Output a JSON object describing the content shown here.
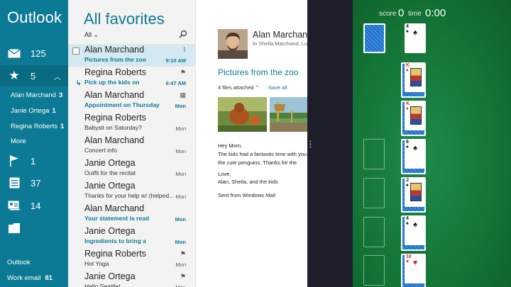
{
  "nav": {
    "app_title": "Outlook",
    "inbox_count": "125",
    "favorites_count": "5",
    "favorites": [
      {
        "name": "Alan Marchand",
        "count": "3"
      },
      {
        "name": "Janie Ortega",
        "count": "1"
      },
      {
        "name": "Regina Roberts",
        "count": "1"
      }
    ],
    "more_label": "More",
    "flagged_count": "1",
    "calendar_count": "37",
    "contacts_count": "14",
    "accounts": [
      {
        "name": "Outlook",
        "count": ""
      },
      {
        "name": "Work email",
        "count": "81"
      }
    ]
  },
  "list": {
    "title": "All favorites",
    "filter": "All",
    "messages": [
      {
        "sender": "Alan Marchand",
        "subject": "Pictures from the zoo",
        "time": "9:10 AM",
        "unread": true,
        "selected": true
      },
      {
        "sender": "Regina Roberts",
        "subject": "Pick up the kids on",
        "time": "6:47 AM",
        "unread": true
      },
      {
        "sender": "Alan Marchand",
        "subject": "Appointment on Thursday",
        "time": "Mon",
        "unread": true
      },
      {
        "sender": "Regina Roberts",
        "subject": "Babysit on Saturday?",
        "time": "Mon"
      },
      {
        "sender": "Alan Marchand",
        "subject": "Concert info",
        "time": "Mon"
      },
      {
        "sender": "Janie Ortega",
        "subject": "Outfit for the recital",
        "time": "Mon"
      },
      {
        "sender": "Janie Ortega",
        "subject": "Thanks for your help w! (helped...",
        "time": "Mon"
      },
      {
        "sender": "Alan Marchand",
        "subject": "Your statement is read",
        "time": "Mon",
        "unread": true
      },
      {
        "sender": "Janie Ortega",
        "subject": "Ingredients to bring a",
        "time": "Mon",
        "unread": true
      },
      {
        "sender": "Regina Roberts",
        "subject": "Hot Yoga",
        "time": "Mon"
      },
      {
        "sender": "Janie Ortega",
        "subject": "Hello Seattle!",
        "time": "Mon"
      }
    ]
  },
  "reading": {
    "from": "Alan Marchand",
    "to": "to Sheila Marchand, Lu",
    "subject": "Pictures from the zoo",
    "attachments": "4 files attached",
    "save_all": "Save all",
    "body": [
      "Hey Mom,",
      "The kids had a fantastic time with you",
      "the cute penguins. Thanks for the",
      "",
      "Love,",
      "Alan, Sheila, and the kids",
      "",
      "Sent from Windows Mail"
    ]
  },
  "game": {
    "score_label": "score",
    "score": "0",
    "time_label": "time",
    "time": "0:00",
    "tableau": [
      {
        "facedown": 0,
        "rank": "4",
        "suit": "♠",
        "color": "black"
      },
      {
        "facedown": 1,
        "rank": "K",
        "suit": "♦",
        "color": "red",
        "face": true
      },
      {
        "facedown": 2,
        "rank": "K",
        "suit": "♦",
        "color": "red",
        "face": true
      },
      {
        "facedown": 3,
        "rank": "6",
        "suit": "♠",
        "color": "black"
      },
      {
        "facedown": 4,
        "rank": "J",
        "suit": "♠",
        "color": "black",
        "face": true
      },
      {
        "facedown": 5,
        "rank": "4",
        "suit": "♠",
        "color": "black"
      },
      {
        "facedown": 6,
        "rank": "10",
        "suit": "♥",
        "color": "red"
      }
    ]
  }
}
